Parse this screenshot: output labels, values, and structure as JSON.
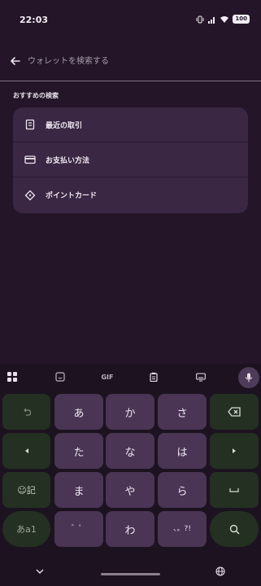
{
  "status": {
    "time": "22:03",
    "battery": "100"
  },
  "search": {
    "placeholder": "ウォレットを検索する"
  },
  "section": {
    "title": "おすすめの検索"
  },
  "suggestions": [
    {
      "label": "最近の取引",
      "icon": "receipt-icon"
    },
    {
      "label": "お支払い方法",
      "icon": "credit-card-icon"
    },
    {
      "label": "ポイントカード",
      "icon": "loyalty-tag-icon"
    }
  ],
  "keyboard": {
    "toolbar": {
      "gif_label": "GIF"
    },
    "rows": [
      [
        "あ",
        "か",
        "さ"
      ],
      [
        "た",
        "な",
        "は"
      ],
      [
        "ま",
        "や",
        "ら"
      ],
      [
        "゛゜",
        "わ",
        "、。?!"
      ]
    ],
    "emoji_label": "☺記",
    "mode_label": "あa1"
  },
  "colors": {
    "background": "#241628",
    "key": "#4a3555",
    "side_key": "#243022",
    "card": "#3a2743"
  }
}
